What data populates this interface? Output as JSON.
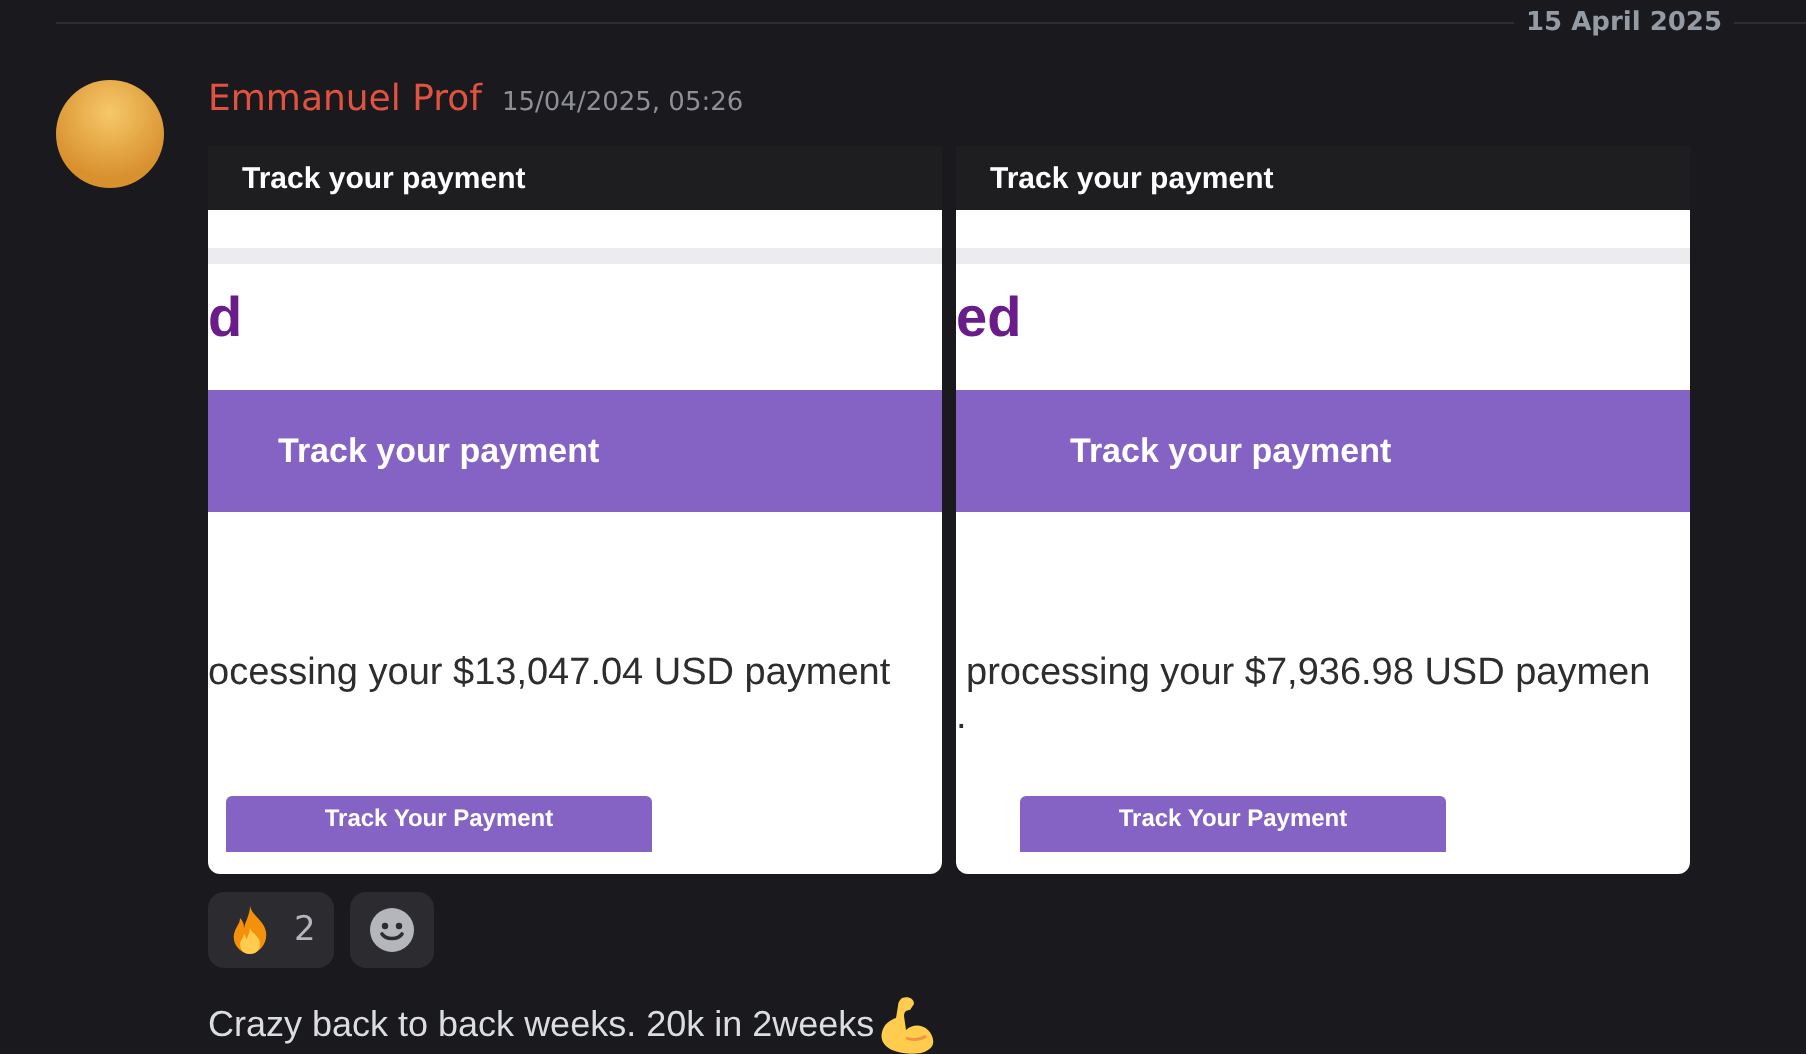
{
  "date_divider": "15 April 2025",
  "message": {
    "author": "Emmanuel Prof",
    "timestamp": "15/04/2025, 05:26",
    "attachments": [
      {
        "header": "Track your payment",
        "logo": "d",
        "banner": "Track your payment",
        "text": "ocessing your $13,047.04 USD payment",
        "button": "Track Your Payment"
      },
      {
        "header": "Track your payment",
        "logo": "ed",
        "banner": "Track your payment",
        "text": "processing your $7,936.98 USD paymen",
        "text_tail": ".",
        "button": "Track Your Payment"
      }
    ],
    "reactions": [
      {
        "kind": "fire",
        "count": "2"
      },
      {
        "kind": "add"
      }
    ],
    "text": "Crazy back to back weeks. 20k in 2weeks"
  }
}
